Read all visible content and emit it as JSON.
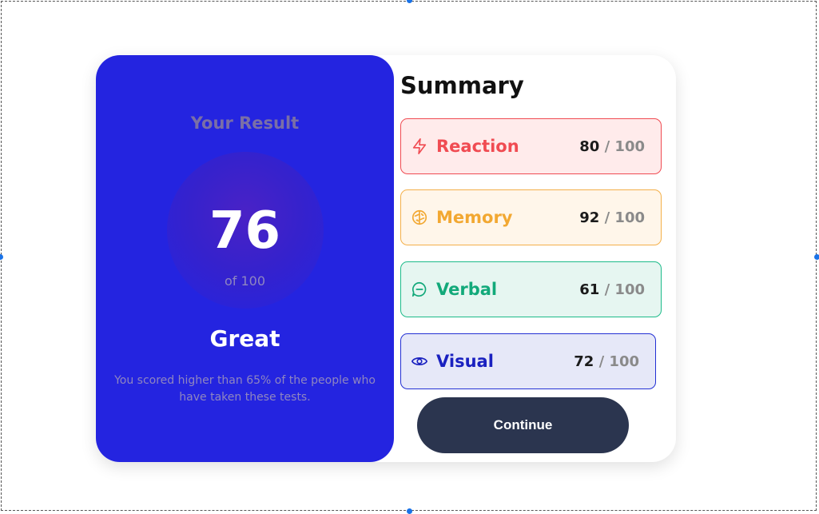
{
  "result": {
    "title": "Your Result",
    "score": "76",
    "of_text": "of 100",
    "rating": "Great",
    "description": "You scored higher than 65% of the people who have taken these tests."
  },
  "summary": {
    "title": "Summary",
    "items": [
      {
        "label": "Reaction",
        "score": "80",
        "max": " / 100",
        "icon": "lightning-icon",
        "color": "#f04b52"
      },
      {
        "label": "Memory",
        "score": "92",
        "max": " / 100",
        "icon": "brain-icon",
        "color": "#f2a832"
      },
      {
        "label": "Verbal",
        "score": "61",
        "max": " / 100",
        "icon": "chat-bubble-icon",
        "color": "#12a97a"
      },
      {
        "label": "Visual",
        "score": "72",
        "max": " / 100",
        "icon": "eye-icon",
        "color": "#1a21c0"
      }
    ]
  },
  "actions": {
    "continue_label": "Continue"
  },
  "colors": {
    "result_bg": "#2424e0",
    "button_bg": "#2b354f"
  }
}
